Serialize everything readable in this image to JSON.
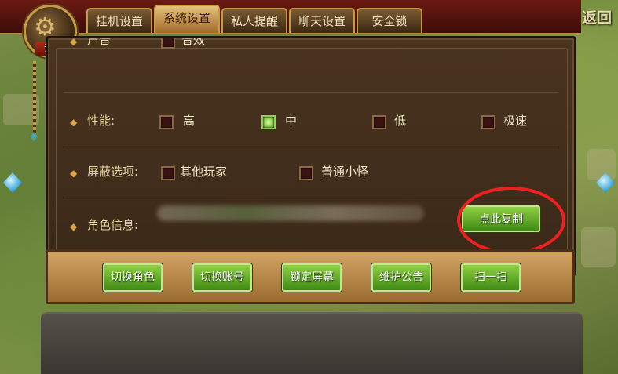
{
  "tabs": [
    {
      "label": "挂机设置"
    },
    {
      "label": "系统设置"
    },
    {
      "label": "私人提醒"
    },
    {
      "label": "聊天设置"
    },
    {
      "label": "安全锁"
    }
  ],
  "active_tab": "系统设置",
  "back_label": "返回",
  "emblem_label": "设置",
  "partial_row": {
    "label": "声音",
    "option": "音效"
  },
  "performance": {
    "label": "性能:",
    "options": [
      {
        "label": "高",
        "checked": false
      },
      {
        "label": "中",
        "checked": true
      },
      {
        "label": "低",
        "checked": false
      },
      {
        "label": "极速",
        "checked": false
      }
    ]
  },
  "shield": {
    "label": "屏蔽选项:",
    "options": [
      {
        "label": "其他玩家",
        "checked": false
      },
      {
        "label": "普通小怪",
        "checked": false
      }
    ]
  },
  "role_info": {
    "label": "角色信息:",
    "copy_button": "点此复制"
  },
  "actions": [
    {
      "label": "切换角色"
    },
    {
      "label": "切换账号"
    },
    {
      "label": "锁定屏幕"
    },
    {
      "label": "维护公告"
    },
    {
      "label": "扫一扫"
    }
  ],
  "colors": {
    "tab_active": "#e4c277",
    "panel_bg": "#3a2818",
    "button_green": "#5aa51e",
    "highlight_ring": "#f02020"
  }
}
